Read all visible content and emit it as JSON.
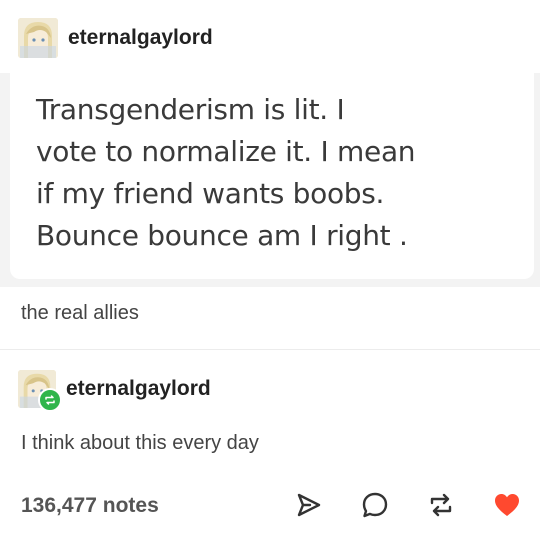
{
  "post": {
    "username": "eternalgaylord",
    "quote_text": "Transgenderism is lit. I\nvote to normalize it. I mean\nif my friend wants boobs.\nBounce bounce am I right .",
    "comment": "the real allies"
  },
  "reblog": {
    "username": "eternalgaylord",
    "text": "I think about this every day"
  },
  "footer": {
    "notes": "136,477 notes",
    "icons": [
      "share-icon",
      "reply-icon",
      "reblog-icon",
      "like-icon"
    ],
    "like_color": "#ff492f"
  },
  "colors": {
    "reblog_badge": "#2fb54b",
    "quote_background": "#f3f3f3"
  }
}
